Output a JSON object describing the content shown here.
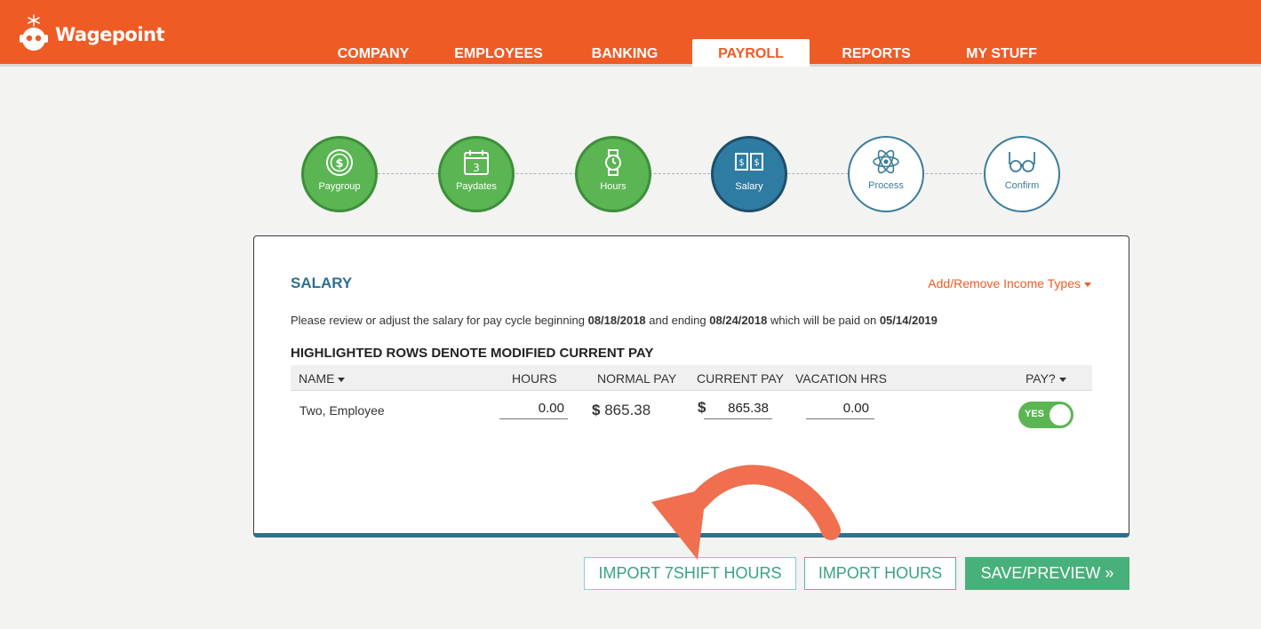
{
  "brand": {
    "name": "Wagepoint",
    "accent": "#ef5b25",
    "success": "#5ab552",
    "primary": "#2f7ca3"
  },
  "nav": {
    "tabs": [
      {
        "label": "COMPANY",
        "active": false
      },
      {
        "label": "EMPLOYEES",
        "active": false
      },
      {
        "label": "BANKING",
        "active": false
      },
      {
        "label": "PAYROLL",
        "active": true
      },
      {
        "label": "REPORTS",
        "active": false
      },
      {
        "label": "MY STUFF",
        "active": false
      }
    ]
  },
  "steps": [
    {
      "label": "Paygroup",
      "state": "done",
      "icon": "dollar-coin-icon"
    },
    {
      "label": "Paydates",
      "state": "done",
      "icon": "calendar-icon"
    },
    {
      "label": "Hours",
      "state": "done",
      "icon": "watch-icon"
    },
    {
      "label": "Salary",
      "state": "current",
      "icon": "money-bills-icon"
    },
    {
      "label": "Process",
      "state": "todo",
      "icon": "atom-icon"
    },
    {
      "label": "Confirm",
      "state": "todo",
      "icon": "glasses-icon"
    }
  ],
  "salary": {
    "title": "SALARY",
    "add_remove_link": "Add/Remove Income Types",
    "description": {
      "prefix": "Please review or adjust the salary for pay cycle beginning",
      "start_date": "08/18/2018",
      "middle": "and ending",
      "end_date": "08/24/2018",
      "suffix": "which will be paid on",
      "pay_date": "05/14/2019"
    },
    "subtitle": "HIGHLIGHTED ROWS DENOTE MODIFIED CURRENT PAY",
    "columns": {
      "name": "NAME",
      "hours": "HOURS",
      "normal_pay": "NORMAL PAY",
      "current_pay": "CURRENT PAY",
      "vacation_hrs": "VACATION HRS",
      "pay": "PAY?"
    },
    "rows": [
      {
        "name": "Two, Employee",
        "hours": "0.00",
        "currency": "$",
        "normal_pay": "865.38",
        "current_pay": "865.38",
        "vacation_hrs": "0.00",
        "pay_toggle": "YES"
      }
    ]
  },
  "actions": {
    "import_7shift": "IMPORT 7SHIFT HOURS",
    "import_hours": "IMPORT HOURS",
    "save_preview": "SAVE/PREVIEW »"
  }
}
